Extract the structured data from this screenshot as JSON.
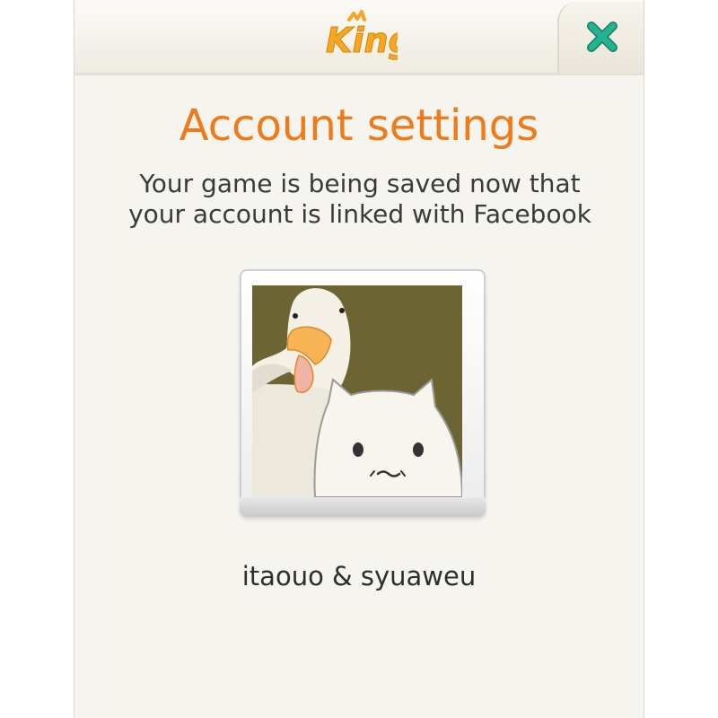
{
  "header": {
    "logo_text": "King",
    "close_icon": "close-x-icon",
    "close_color": "#1fa886"
  },
  "main": {
    "title": "Account settings",
    "subtitle_line1": "Your game is being saved now that",
    "subtitle_line2": "your account is linked with Facebook",
    "avatar_icon": "profile-picture-duck-and-cat",
    "username": "itaouo & syuaweu"
  },
  "colors": {
    "title": "#f07a18",
    "panel_bg": "#f6f4ef",
    "logo": "#f5a623"
  }
}
